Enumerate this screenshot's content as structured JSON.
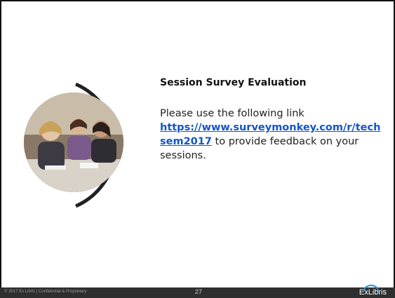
{
  "slide": {
    "title": "Session Survey Evaluation",
    "intro_text": "Please use the following link ",
    "link_text": "https://www.surveymonkey.com/r/techsem2017",
    "outro_text": " to provide feedback on your sessions."
  },
  "footer": {
    "copyright": "© 2017 Ex Libris | Confidential & Proprietary",
    "page_number": "27",
    "logo_text": "ExLibris"
  },
  "colors": {
    "link": "#1155cc",
    "footer_bg": "#2f2f2f",
    "logo_arc": "#2b8fd6"
  }
}
